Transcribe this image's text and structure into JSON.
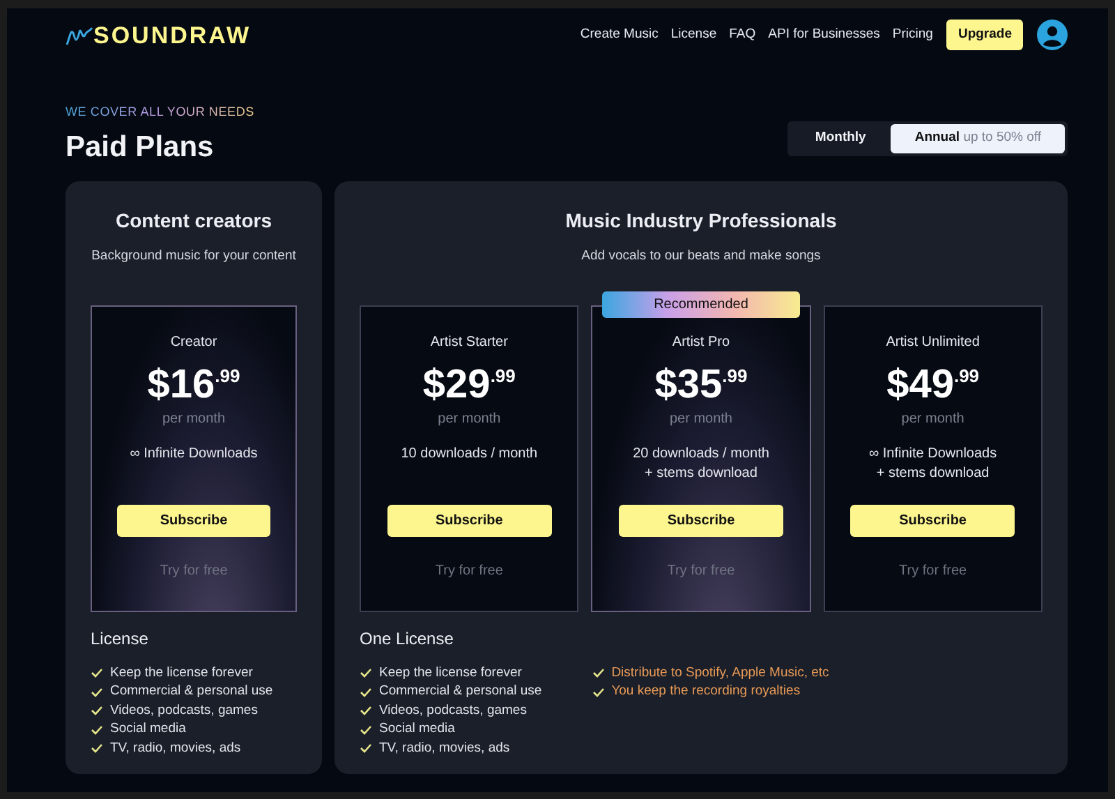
{
  "logo": {
    "text": "SOUNDRAW"
  },
  "nav": [
    "Create Music",
    "License",
    "FAQ",
    "API for Businesses",
    "Pricing"
  ],
  "upgrade_button": "Upgrade",
  "eyebrow": "WE COVER ALL YOUR NEEDS",
  "title": "Paid Plans",
  "billing_toggle": [
    {
      "label": "Monthly",
      "selected": false
    },
    {
      "label": "Annual",
      "note": "up to 50% off",
      "selected": true
    }
  ],
  "groups": [
    {
      "title": "Content creators",
      "subtitle": "Background music for your content",
      "plans": [
        {
          "name": "Creator",
          "price": "$16",
          "cents": ".99",
          "period": "per month",
          "features": [
            "∞ Infinite Downloads"
          ],
          "button": "Subscribe",
          "trial": "Try for free",
          "highlighted": true
        }
      ],
      "license_title": "License",
      "license_columns": [
        [
          {
            "text": "Keep the license forever",
            "highlighted": false
          },
          {
            "text": "Commercial & personal use",
            "highlighted": false
          },
          {
            "text": "Videos, podcasts, games",
            "highlighted": false
          },
          {
            "text": "Social media",
            "highlighted": false
          },
          {
            "text": "TV, radio, movies, ads",
            "highlighted": false
          }
        ]
      ]
    },
    {
      "title": "Music Industry Professionals",
      "subtitle": "Add vocals to our beats and make songs",
      "plans": [
        {
          "name": "Artist Starter",
          "price": "$29",
          "cents": ".99",
          "period": "per month",
          "features": [
            "10 downloads / month"
          ],
          "button": "Subscribe",
          "trial": "Try for free",
          "highlighted": false
        },
        {
          "name": "Artist Pro",
          "price": "$35",
          "cents": ".99",
          "period": "per month",
          "features": [
            "20 downloads / month",
            "+ stems download"
          ],
          "button": "Subscribe",
          "trial": "Try for free",
          "highlighted": true,
          "badge": "Recommended"
        },
        {
          "name": "Artist Unlimited",
          "price": "$49",
          "cents": ".99",
          "period": "per month",
          "features": [
            "∞ Infinite Downloads",
            "+ stems download"
          ],
          "button": "Subscribe",
          "trial": "Try for free",
          "highlighted": false
        }
      ],
      "license_title": "One License",
      "license_columns": [
        [
          {
            "text": "Keep the license forever",
            "highlighted": false
          },
          {
            "text": "Commercial & personal use",
            "highlighted": false
          },
          {
            "text": "Videos, podcasts, games",
            "highlighted": false
          },
          {
            "text": "Social media",
            "highlighted": false
          },
          {
            "text": "TV, radio, movies, ads",
            "highlighted": false
          }
        ],
        [
          {
            "text": "Distribute to Spotify, Apple Music, etc",
            "highlighted": true
          },
          {
            "text": "You keep the recording royalties",
            "highlighted": true
          }
        ]
      ]
    }
  ]
}
